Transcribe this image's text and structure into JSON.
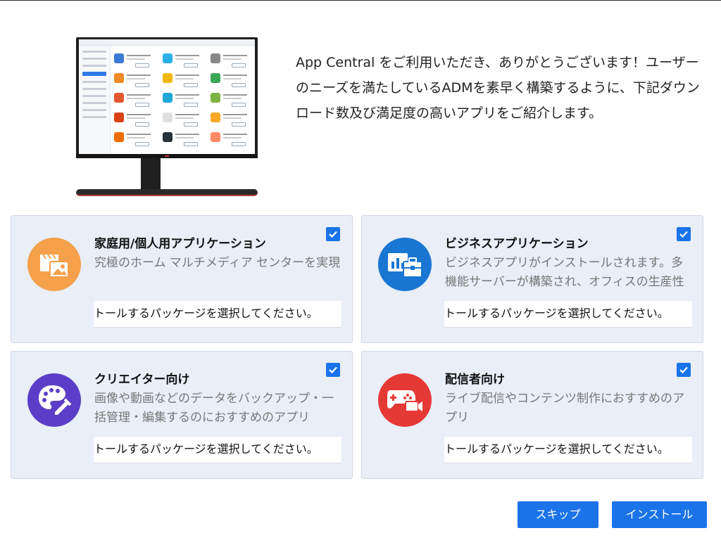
{
  "intro": {
    "text": "App Central をご利用いただき、ありがとうございます！ユーザーのニーズを満たしているADMを素早く構築するように、下記ダウンロード数及び満足度の高いアプリをご紹介します。"
  },
  "colors": {
    "accent": "#1a73e8",
    "card_bg": "#e9eef7",
    "home_icon": "#f5a04a",
    "business_icon": "#1976d2",
    "creator_icon": "#5b3ec8",
    "streamer_icon": "#e53935"
  },
  "cards": [
    {
      "title": "家庭用/個人用アプリケーション",
      "description": "究極のホーム マルチメディア センターを実現",
      "select_text": "トールするパッケージを選択してください。",
      "icon": "media-icon",
      "checked": true
    },
    {
      "title": "ビジネスアプリケーション",
      "description": "ビジネスアプリがインストールされます。多機能サーバーが構築され、オフィスの生産性が上がります。",
      "select_text": "トールするパッケージを選択してください。",
      "icon": "business-icon",
      "checked": true
    },
    {
      "title": "クリエイター向け",
      "description": "画像や動画などのデータをバックアップ・一括管理・編集するのにおすすめのアプリ",
      "select_text": "トールするパッケージを選択してください。",
      "icon": "palette-icon",
      "checked": true
    },
    {
      "title": "配信者向け",
      "description": "ライブ配信やコンテンツ制作におすすめのアプリ",
      "select_text": "トールするパッケージを選択してください。",
      "icon": "gamepad-camera-icon",
      "checked": true
    }
  ],
  "buttons": {
    "skip": "スキップ",
    "install": "インストール"
  }
}
